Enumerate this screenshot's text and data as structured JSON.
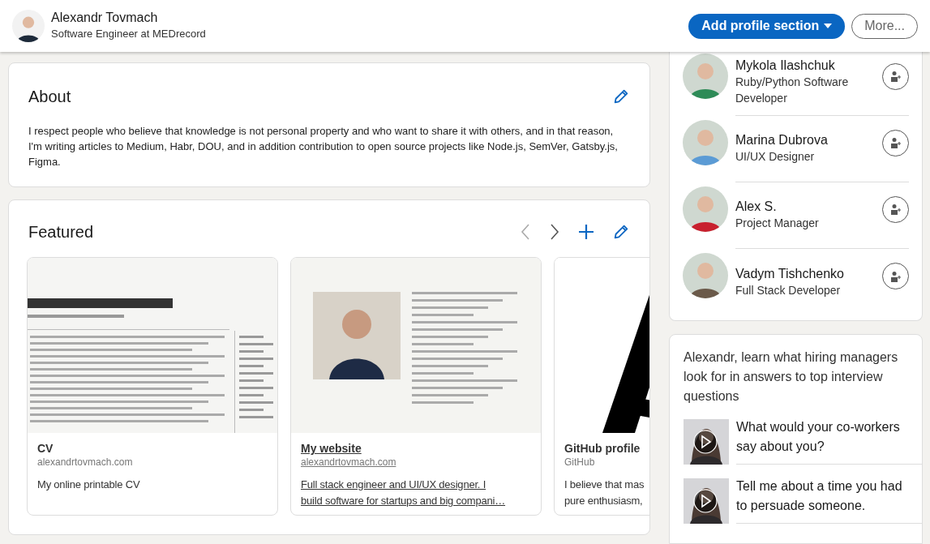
{
  "header": {
    "name": "Alexandr Tovmach",
    "headline": "Software Engineer at MEDrecord",
    "buttons": [
      {
        "label": "Add profile section",
        "kind": "primary"
      },
      {
        "label": "More...",
        "kind": "secondary"
      }
    ]
  },
  "about": {
    "title": "About",
    "text": "I respect people who believe that knowledge is not personal property and who want to share it with others, and in that reason, I'm writing articles to Medium, Habr, DOU, and in addition contribution to open source projects like Node.js, SemVer, Gatsby.js, Figma."
  },
  "featured": {
    "title": "Featured",
    "items": [
      {
        "title": "CV",
        "source": "alexandrtovmach.com",
        "description": [
          "My online printable CV"
        ],
        "hovered": false
      },
      {
        "title": "My website",
        "source": "alexandrtovmach.com",
        "description": [
          "Full stack engineer and UI/UX designer. I",
          "build software for startups and big compani…"
        ],
        "hovered": true
      },
      {
        "title": "GitHub profile",
        "source": "GitHub",
        "description": [
          "I believe that mas",
          "pure enthusiasm,"
        ],
        "hovered": false
      }
    ]
  },
  "people": [
    {
      "name": "Mykola Ilashchuk",
      "headline": "Ruby/Python Software Developer"
    },
    {
      "name": "Marina Dubrova",
      "headline": "UI/UX Designer"
    },
    {
      "name": "Alex S.",
      "headline": "Project Manager"
    },
    {
      "name": "Vadym Tishchenko",
      "headline": "Full Stack Developer"
    }
  ],
  "interview": {
    "prompt": "Alexandr, learn what hiring managers look for in answers to top interview questions",
    "questions": [
      "What would your co-workers say about you?",
      "Tell me about a time you had to persuade someone."
    ]
  }
}
